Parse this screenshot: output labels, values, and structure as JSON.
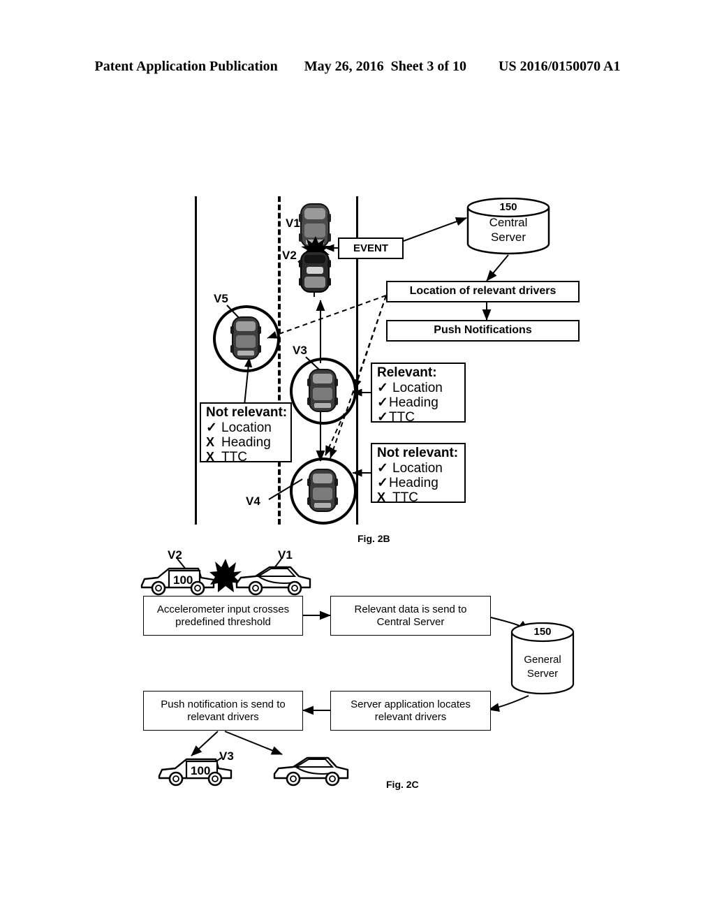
{
  "header": {
    "publication": "Patent Application Publication",
    "date": "May 26, 2016",
    "sheet": "Sheet 3 of 10",
    "patent_number": "US 2016/0150070 A1"
  },
  "fig2b": {
    "caption": "Fig. 2B",
    "vehicle_labels": {
      "v1": "V1",
      "v2": "V2",
      "v3": "V3",
      "v4": "V4",
      "v5": "V5"
    },
    "event_box": "EVENT",
    "central_server": {
      "number": "150",
      "name": "Central\nServer"
    },
    "location_box": "Location of relevant drivers",
    "push_box": "Push Notifications",
    "status_v5": {
      "title": "Not relevant:",
      "rows": [
        {
          "mark": "✓",
          "mark_type": "check",
          "label": "Location"
        },
        {
          "mark": "X",
          "mark_type": "cross",
          "label": "Heading"
        },
        {
          "mark": "X",
          "mark_type": "cross",
          "label": "TTC"
        }
      ]
    },
    "status_v3": {
      "title": "Relevant:",
      "rows": [
        {
          "mark": "✓",
          "mark_type": "check",
          "label": "Location"
        },
        {
          "mark": "✓",
          "mark_type": "check",
          "label": "Heading"
        },
        {
          "mark": "✓",
          "mark_type": "check",
          "label": "TTC"
        }
      ]
    },
    "status_v4": {
      "title": "Not relevant:",
      "rows": [
        {
          "mark": "✓",
          "mark_type": "check",
          "label": "Location"
        },
        {
          "mark": "✓",
          "mark_type": "check",
          "label": "Heading"
        },
        {
          "mark": "X",
          "mark_type": "cross",
          "label": "TTC"
        }
      ]
    }
  },
  "fig2c": {
    "caption": "Fig. 2C",
    "crash_labels": {
      "v2": "V2",
      "v1": "V1",
      "device_number": "100"
    },
    "steps": {
      "accelerometer": "Accelerometer input crosses\npredefined threshold",
      "send_data": "Relevant data is send to\nCentral Server",
      "locate": "Server application locates\nrelevant drivers",
      "push": "Push notification is send to\nrelevant drivers"
    },
    "general_server": {
      "number": "150",
      "name": "General\nServer"
    },
    "result_labels": {
      "v3": "V3",
      "device_number": "100"
    }
  },
  "colors": {
    "ink": "#000000",
    "paper": "#ffffff"
  }
}
